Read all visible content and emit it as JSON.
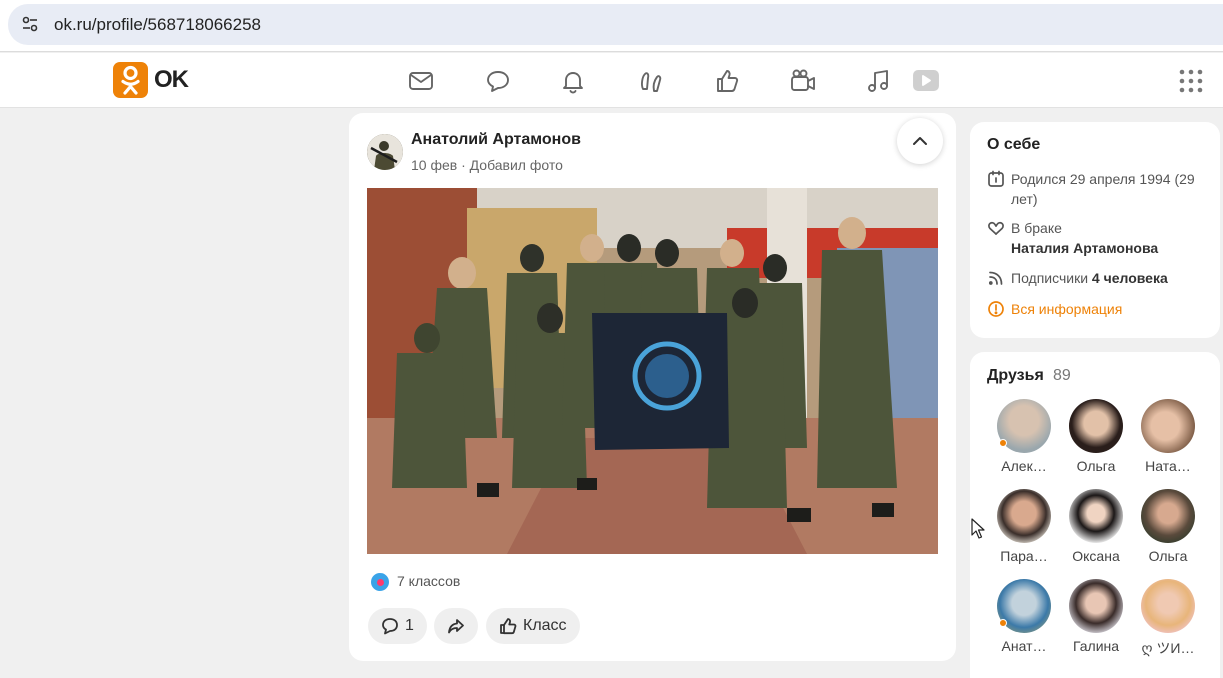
{
  "browser": {
    "url": "ok.ru/profile/568718066258",
    "site_icon": "tune-icon"
  },
  "topnav": {
    "logo_text": "OK",
    "brand_color": "#ee8208",
    "icons": [
      "mail-icon",
      "chat-icon",
      "bell-icon",
      "guests-icon",
      "like-icon",
      "camera-icon",
      "music-icon",
      "video-icon",
      "apps-grid-icon"
    ]
  },
  "post": {
    "author": "Анатолий Артамонов",
    "meta": "10 фев · Добавил фото",
    "likes_text": "7 классов",
    "comments_count": "1",
    "class_label": "Класс",
    "photo_description_icon": "photo"
  },
  "about": {
    "title": "О себе",
    "birth": "Родился 29 апреля 1994 (29 лет)",
    "marital_status": "В браке",
    "spouse": "Наталия Артамонова",
    "followers_label": "Подписчики",
    "followers_value": "4 человека",
    "all_info_link": "Вся информация"
  },
  "friends": {
    "title": "Друзья",
    "count": "89",
    "items": [
      {
        "name": "Алек…",
        "online": true,
        "color": "#c9b6a6"
      },
      {
        "name": "Ольга",
        "online": false,
        "color": "#3a2a24"
      },
      {
        "name": "Ната…",
        "online": false,
        "color": "#b58b72"
      },
      {
        "name": "Пара…",
        "online": false,
        "color": "#d8c9b8"
      },
      {
        "name": "Оксана",
        "online": false,
        "color": "#2a2222"
      },
      {
        "name": "Ольга",
        "online": false,
        "color": "#6a5b4a"
      },
      {
        "name": "Анат…",
        "online": true,
        "color": "#8fa7b8"
      },
      {
        "name": "Галина",
        "online": false,
        "color": "#c5b0a7"
      },
      {
        "name": "ღ ツИ…",
        "online": false,
        "color": "#e6c8a0"
      }
    ]
  }
}
